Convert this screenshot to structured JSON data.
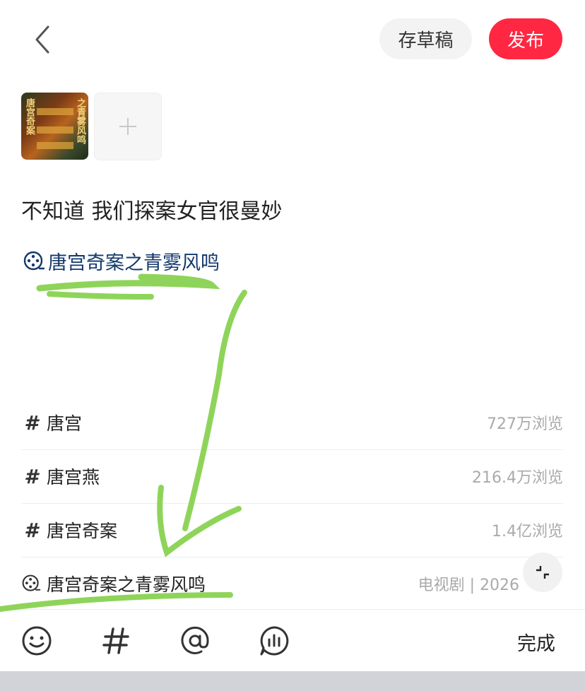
{
  "header": {
    "draft_label": "存草稿",
    "publish_label": "发布"
  },
  "images": {
    "thumb_text_left": "唐宫奇案",
    "thumb_text_right": "之青雾风鸣"
  },
  "post": {
    "title": "不知道 我们探案女官很曼妙",
    "tag": "唐宫奇案之青雾风鸣"
  },
  "suggestions": [
    {
      "icon": "hash",
      "label": "唐宫",
      "meta": "727万浏览"
    },
    {
      "icon": "hash",
      "label": "唐宫燕",
      "meta": "216.4万浏览"
    },
    {
      "icon": "hash",
      "label": "唐宫奇案",
      "meta": "1.4亿浏览"
    },
    {
      "icon": "film-reel",
      "label": "唐宫奇案之青雾风鸣",
      "meta": "电视剧 | 2026"
    }
  ],
  "toolbar": {
    "done_label": "完成",
    "icons": [
      "emoji-icon",
      "hashtag-icon",
      "at-icon",
      "vote-icon"
    ]
  },
  "colors": {
    "brand": "#ff2741",
    "tag_text": "#13386c",
    "annotation": "#8fd45a"
  }
}
